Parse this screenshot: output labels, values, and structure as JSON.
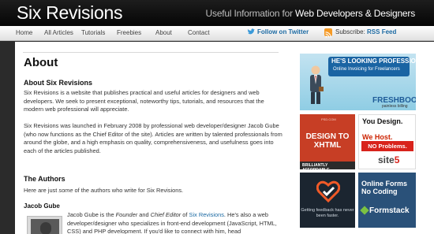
{
  "header": {
    "site_title": "Six Revisions",
    "tagline_prefix": "Useful Information for",
    "tagline_highlight": "Web Developers & Designers"
  },
  "nav": {
    "items": [
      "Home",
      "All Articles",
      "Tutorials",
      "Freebies",
      "About",
      "Contact"
    ],
    "twitter_label": "Follow on Twitter",
    "rss_prefix": "Subscribe:",
    "rss_label": "RSS Feed"
  },
  "content": {
    "title": "About",
    "about_heading": "About Six Revisions",
    "para1": "Six Revisions is a website that publishes practical and useful articles for designers and web developers. We seek to present exceptional, noteworthy tips, tutorials, and resources that the modern web professional will appreciate.",
    "para2": "Six Revisions was launched in February 2008 by professional web developer/designer Jacob Gube (who now functions as the Chief Editor of the site). Articles are written by talented professionals from around the globe, and a high emphasis on quality, comprehensiveness, and usefulness goes into each of the articles published.",
    "authors_heading": "The Authors",
    "authors_intro_a": "Here are just ",
    "authors_intro_em": "some",
    "authors_intro_b": " of the authors who write for Six Revisions.",
    "author_name": "Jacob Gube",
    "bio_a": "Jacob Gube is the ",
    "bio_em1": "Founder",
    "bio_b": " and ",
    "bio_em2": "Chief Editor",
    "bio_c": " of ",
    "bio_link": "Six Revisions",
    "bio_d": ". He's also a web developer/designer who specializes in front-end development (JavaScript, HTML, CSS) and PHP development. If you'd like to connect with him, head"
  },
  "ads": {
    "freshbooks_headline": "HE'S LOOKING PROFESSIONAL",
    "freshbooks_sub": "Online Invoicing for Freelancers",
    "freshbooks_logo": "FRESHBOOKS",
    "freshbooks_tag": "painless billing",
    "xhtml_small": "PSD.COM",
    "xhtml_text": "DESIGN TO XHTML",
    "xhtml_bar": "BRILLIANTLY AFFORDABLE",
    "site5_line1": "You Design.",
    "site5_line2": "We Host.",
    "site5_line3": "NO Problems.",
    "site5_logo_a": "site",
    "site5_logo_b": "5",
    "heart_text": "Getting feedback has never been faster.",
    "formstack_text": "Online Forms No Coding",
    "formstack_logo": "Formstack"
  },
  "colors": {
    "link_blue": "#1c6aa3",
    "header_black": "#050505",
    "background_dark": "#2b2b2b"
  }
}
